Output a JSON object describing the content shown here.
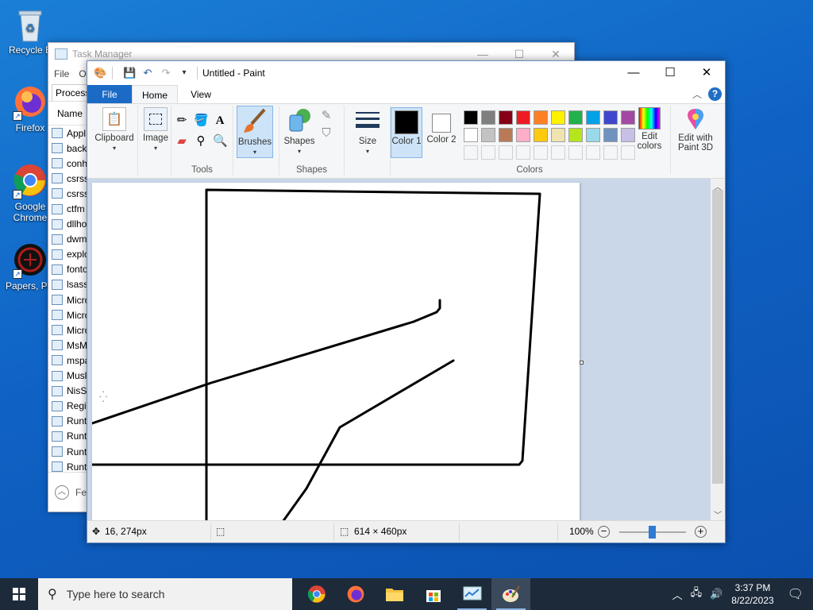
{
  "desktop": {
    "icons": [
      {
        "label": "Recycle B",
        "icon": "recycle-bin-icon"
      },
      {
        "label": "Firefox",
        "icon": "firefox-icon"
      },
      {
        "label": "Google Chrome",
        "icon": "chrome-icon"
      },
      {
        "label": "Papers, Ple",
        "icon": "papers-please-icon"
      }
    ]
  },
  "task_manager": {
    "title": "Task Manager",
    "menu": [
      "File",
      "O"
    ],
    "tab": "Process",
    "column_header": "Name",
    "rows": [
      "Appl",
      "back",
      "conh",
      "csrss",
      "csrss",
      "ctfm",
      "dllho",
      "dwm",
      "explo",
      "fonto",
      "lsass.",
      "Micro",
      "Micro",
      "Micro",
      "MsM",
      "mspa",
      "Musl",
      "NisSr",
      "Regis",
      "Runt",
      "Runt",
      "Runt",
      "Runt"
    ],
    "footer": "Fe"
  },
  "paint": {
    "title": "Untitled - Paint",
    "tabs": {
      "file": "File",
      "home": "Home",
      "view": "View"
    },
    "groups": {
      "clipboard": "Clipboard",
      "image": "Image",
      "tools": "Tools",
      "brushes": "Brushes",
      "shapes_btn": "Shapes",
      "shapes": "Shapes",
      "size": "Size",
      "color1": "Color 1",
      "color2": "Color 2",
      "edit_colors": "Edit colors",
      "edit_paint3d": "Edit with Paint 3D",
      "colors": "Colors"
    },
    "palette_row1": [
      "#000000",
      "#7f7f7f",
      "#880015",
      "#ed1c24",
      "#ff7f27",
      "#fff200",
      "#22b14c",
      "#00a2e8",
      "#3f48cc",
      "#a349a4"
    ],
    "palette_row2": [
      "#ffffff",
      "#c3c3c3",
      "#b97a57",
      "#ffaec9",
      "#ffc90e",
      "#efe4b0",
      "#b5e61d",
      "#99d9ea",
      "#7092be",
      "#c8bfe7"
    ],
    "color1_value": "#000000",
    "color2_value": "#ffffff",
    "status": {
      "cursor_pos": "16, 274px",
      "canvas_size": "614 × 460px",
      "zoom": "100%"
    }
  },
  "taskbar": {
    "search_placeholder": "Type here to search",
    "time": "3:37 PM",
    "date": "8/22/2023"
  }
}
